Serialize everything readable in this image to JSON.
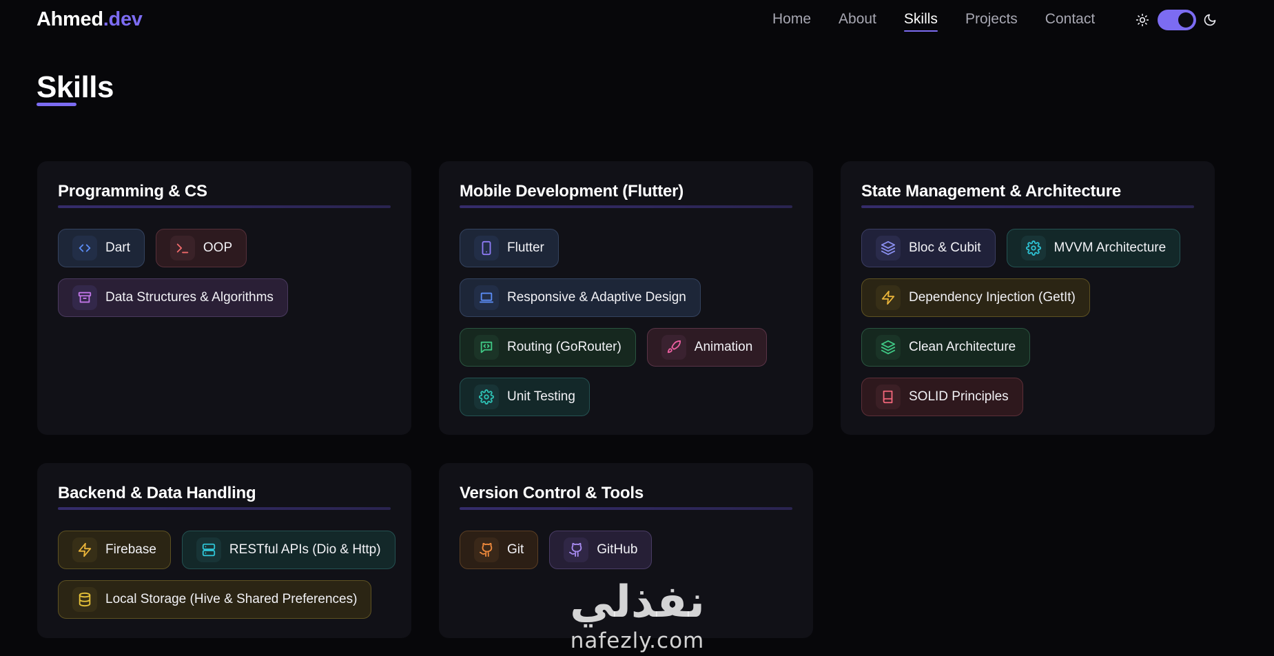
{
  "brand": {
    "name": "Ahmed",
    "suffix": ".dev"
  },
  "nav": {
    "items": [
      {
        "label": "Home",
        "active": false
      },
      {
        "label": "About",
        "active": false
      },
      {
        "label": "Skills",
        "active": true
      },
      {
        "label": "Projects",
        "active": false
      },
      {
        "label": "Contact",
        "active": false
      }
    ],
    "theme_toggle": {
      "state": "dark",
      "icons": [
        "sun-icon",
        "moon-icon"
      ]
    }
  },
  "page": {
    "title": "Skills"
  },
  "colors": {
    "accent": "#7c6cf2",
    "background": "#07070a",
    "card": "#111117"
  },
  "cards": [
    {
      "title": "Programming & CS",
      "rows": [
        [
          {
            "label": "Dart",
            "icon": "code-icon",
            "theme": "blue"
          },
          {
            "label": "OOP",
            "icon": "terminal-icon",
            "theme": "red"
          }
        ],
        [
          {
            "label": "Data Structures & Algorithms",
            "icon": "archive-icon",
            "theme": "purple"
          }
        ]
      ]
    },
    {
      "title": "Mobile Development (Flutter)",
      "rows": [
        [
          {
            "label": "Flutter",
            "icon": "smartphone-icon",
            "theme": "blue"
          }
        ],
        [
          {
            "label": "Responsive & Adaptive Design",
            "icon": "laptop-icon",
            "theme": "blue"
          }
        ],
        [
          {
            "label": "Routing (GoRouter)",
            "icon": "message-code-icon",
            "theme": "green"
          },
          {
            "label": "Animation",
            "icon": "rocket-icon",
            "theme": "pink"
          }
        ],
        [
          {
            "label": "Unit Testing",
            "icon": "gear-icon",
            "theme": "teal"
          }
        ]
      ]
    },
    {
      "title": "State Management & Architecture",
      "rows": [
        [
          {
            "label": "Bloc & Cubit",
            "icon": "layers-icon",
            "theme": "indigo"
          },
          {
            "label": "MVVM Architecture",
            "icon": "gear-icon",
            "theme": "teal"
          }
        ],
        [
          {
            "label": "Dependency Injection (GetIt)",
            "icon": "lightning-icon",
            "theme": "yellow"
          }
        ],
        [
          {
            "label": "Clean Architecture",
            "icon": "layers-icon",
            "theme": "emerald"
          }
        ],
        [
          {
            "label": "SOLID Principles",
            "icon": "book-icon",
            "theme": "rose"
          }
        ]
      ]
    },
    {
      "title": "Backend & Data Handling",
      "rows": [
        [
          {
            "label": "Firebase",
            "icon": "lightning-icon",
            "theme": "yellow"
          },
          {
            "label": "RESTful APIs (Dio & Http)",
            "icon": "server-icon",
            "theme": "teal"
          }
        ],
        [
          {
            "label": "Local Storage (Hive & Shared Preferences)",
            "icon": "database-icon",
            "theme": "yellow"
          }
        ]
      ]
    },
    {
      "title": "Version Control & Tools",
      "rows": [
        [
          {
            "label": "Git",
            "icon": "github-icon",
            "theme": "orange"
          },
          {
            "label": "GitHub",
            "icon": "github-icon",
            "theme": "violet"
          }
        ]
      ]
    }
  ],
  "watermark": {
    "arabic": "نفذلي",
    "latin": "nafezly.com"
  }
}
